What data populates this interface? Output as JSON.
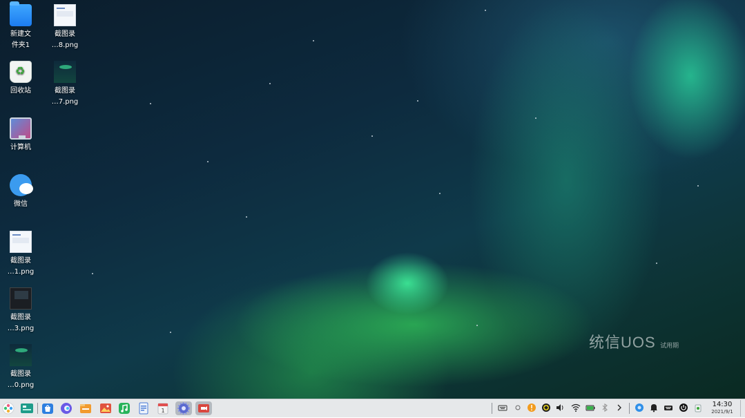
{
  "desktop": {
    "icons": [
      {
        "label": "新建文\n件夹1",
        "icon": "folder-icon"
      },
      {
        "label": "截图录\n…8.png",
        "icon": "screenshot-thumb-icon"
      },
      {
        "label": "回收站",
        "icon": "trash-icon"
      },
      {
        "label": "截图录\n…7.png",
        "icon": "screenshot-thumb-icon"
      },
      {
        "label": "计算机",
        "icon": "computer-icon"
      },
      {
        "label": "微信",
        "icon": "wechat-icon"
      },
      {
        "label": "截图录\n…1.png",
        "icon": "screenshot-thumb-icon"
      },
      {
        "label": "截图录\n…3.png",
        "icon": "screenshot-thumb-icon"
      },
      {
        "label": "截图录\n…0.png",
        "icon": "screenshot-thumb-icon"
      }
    ],
    "watermark": {
      "brand": "统信UOS",
      "edition": "试用期"
    }
  },
  "taskbar": {
    "apps": [
      {
        "name": "launcher-icon",
        "color": "#e85a8c"
      },
      {
        "name": "multitask-view-icon",
        "color": "#1e9c8a"
      },
      {
        "name": "app-store-icon",
        "color": "#2d7fe0"
      },
      {
        "name": "browser-icon",
        "color": "#6a59e6"
      },
      {
        "name": "file-manager-icon",
        "color": "#f29b2f"
      },
      {
        "name": "image-viewer-icon",
        "color": "#e0523f"
      },
      {
        "name": "music-icon",
        "color": "#27b35a"
      },
      {
        "name": "document-viewer-icon",
        "color": "#4a7bd6"
      },
      {
        "name": "calendar-icon",
        "color": "#f3f3f3"
      },
      {
        "name": "system-settings-icon",
        "color": "#5b6bd0"
      },
      {
        "name": "screen-recorder-icon",
        "color": "#d9463e"
      }
    ],
    "tray": {
      "time": "14:30",
      "date": "2021/9/1"
    }
  }
}
